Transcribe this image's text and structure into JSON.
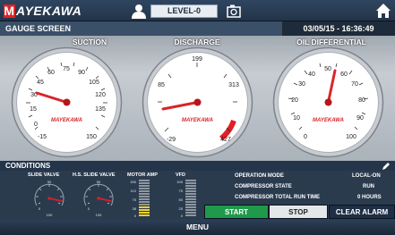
{
  "header": {
    "logo_text": "AYEKAWA",
    "logo_badge": "M",
    "user_level": "LEVEL-0"
  },
  "titlebar": {
    "title": "GAUGE SCREEN",
    "datetime": "03/05/15 - 16:36:49"
  },
  "gauges": [
    {
      "label": "SUCTION",
      "brand": "MAYEKAWA",
      "ticks": [
        "-15",
        "0",
        "15",
        "30",
        "45",
        "60",
        "75",
        "90",
        "105",
        "120",
        "135",
        "150"
      ],
      "value": 32
    },
    {
      "label": "DISCHARGE",
      "brand": "MAYEKAWA",
      "ticks": [
        "-29",
        "85",
        "199",
        "313",
        "427"
      ],
      "value": 40
    },
    {
      "label": "OIL DIFFERENTIAL",
      "brand": "MAYEKAWA",
      "ticks": [
        "0",
        "10",
        "20",
        "30",
        "40",
        "50",
        "60",
        "70",
        "80",
        "90",
        "100"
      ],
      "value": 53
    }
  ],
  "conditions": {
    "title": "CONDITIONS",
    "slide_valve_label": "SLIDE VALVE",
    "hs_slide_valve_label": "H.S. SLIDE VALVE",
    "motor_amp_label": "MOTOR AMP",
    "vfd_label": "VFD",
    "motor_amp_ticks": [
      "150",
      "112",
      "75",
      "38",
      "0"
    ],
    "vfd_ticks": [
      "100",
      "75",
      "50",
      "25",
      "0"
    ],
    "mini_gauge_ticks": [
      "0",
      "50",
      "100"
    ],
    "operation_mode_label": "OPERATION MODE",
    "operation_mode_value": "LOCAL-ON",
    "compressor_state_label": "COMPRESSOR STATE",
    "compressor_state_value": "RUN",
    "run_time_label": "COMPRESSOR TOTAL RUN TIME",
    "run_time_value": "0 HOURS"
  },
  "buttons": {
    "start": "START",
    "stop": "STOP",
    "clear_alarm": "CLEAR ALARM"
  },
  "menu": {
    "label": "MENU"
  },
  "colors": {
    "accent_red": "#d9252a",
    "start_green": "#1f9a4a",
    "header_navy": "#223449"
  }
}
